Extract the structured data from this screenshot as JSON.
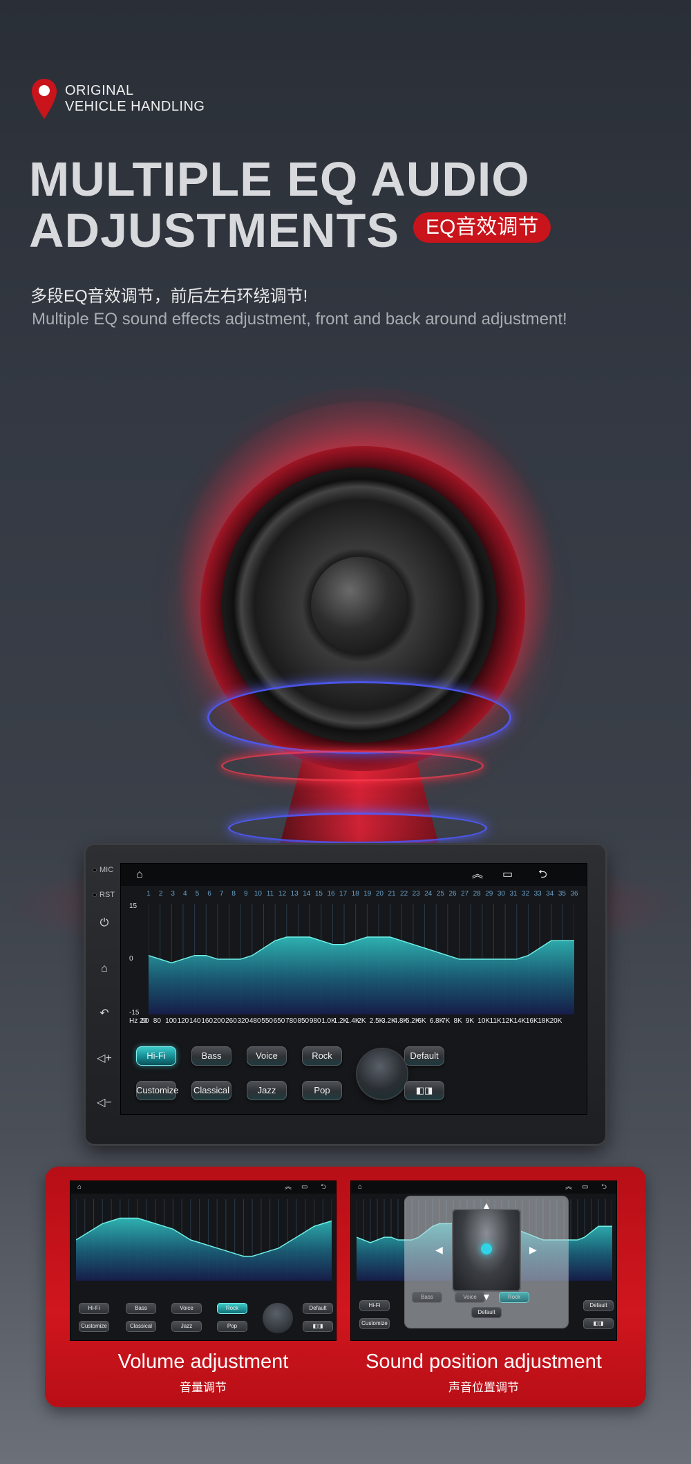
{
  "header": {
    "brand_line1": "ORIGINAL",
    "brand_line2": "VEHICLE HANDLING",
    "headline_line1": "MULTIPLE EQ AUDIO",
    "headline_line2": "ADJUSTMENTS",
    "badge": "EQ音效调节",
    "subtitle_cn": "多段EQ音效调节，前后左右环绕调节!",
    "subtitle_en": "Multiple EQ sound effects adjustment, front and back around adjustment!"
  },
  "colors": {
    "accent_red": "#c9141b",
    "teal": "#1fa8b0",
    "background": "#2f343c"
  },
  "device": {
    "side_labels": [
      "MIC",
      "RST"
    ],
    "side_icons": [
      "power-icon",
      "home-icon",
      "back-icon",
      "volume-up-icon",
      "volume-down-icon"
    ],
    "status_icons": [
      "home-outline-icon",
      "chevron-up-icon",
      "recent-apps-icon",
      "back-icon"
    ],
    "eq": {
      "bands": [
        "1",
        "2",
        "3",
        "4",
        "5",
        "6",
        "7",
        "8",
        "9",
        "10",
        "11",
        "12",
        "13",
        "14",
        "15",
        "16",
        "17",
        "18",
        "19",
        "20",
        "21",
        "22",
        "23",
        "24",
        "25",
        "26",
        "27",
        "28",
        "29",
        "30",
        "31",
        "32",
        "33",
        "34",
        "35",
        "36"
      ],
      "y_top": "15",
      "y_mid": "0",
      "y_bottom": "-15",
      "freq_labels": [
        "Hz 20",
        "60",
        "80",
        "100",
        "120",
        "140",
        "160",
        "200",
        "260",
        "320",
        "480",
        "550",
        "650",
        "780",
        "850",
        "980",
        "1.0K",
        "1.2K",
        "1.4K",
        "2K",
        "2.5K",
        "3.2K",
        "4.8K",
        "5.2K",
        "6K",
        "6.8K",
        "7K",
        "8K",
        "9K",
        "10K",
        "11K",
        "12K",
        "14K",
        "16K",
        "18K",
        "20K"
      ],
      "values": [
        1,
        0,
        -1,
        0,
        1,
        1,
        0,
        0,
        0,
        1,
        3,
        5,
        6,
        6,
        6,
        5,
        4,
        4,
        5,
        6,
        6,
        6,
        5,
        4,
        3,
        2,
        1,
        0,
        0,
        0,
        0,
        0,
        0,
        1,
        3,
        5,
        5,
        5
      ]
    },
    "buttons": {
      "hifi": "Hi-Fi",
      "bass": "Bass",
      "voice": "Voice",
      "rock": "Rock",
      "default": "Default",
      "customize": "Customize",
      "classical": "Classical",
      "jazz": "Jazz",
      "pop": "Pop"
    },
    "active_preset": "Hi-Fi"
  },
  "panels": {
    "left_title": "Volume adjustment",
    "left_subtitle": "音量调节",
    "right_title": "Sound position adjustment",
    "right_subtitle": "声音位置调节",
    "left_active_preset": "Rock",
    "right_active_preset": "Rock",
    "popup_default": "Default"
  }
}
